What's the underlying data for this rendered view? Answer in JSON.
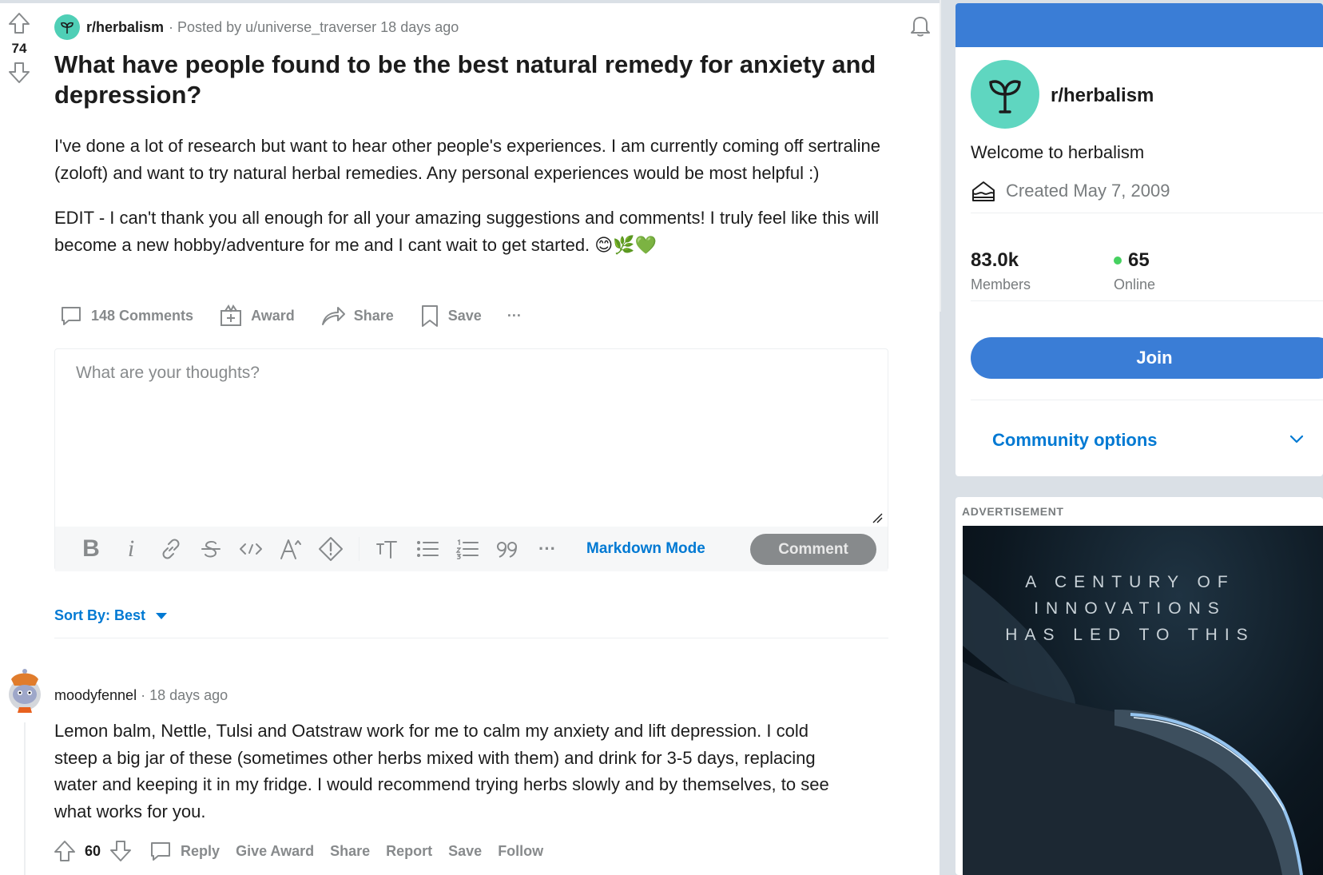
{
  "post": {
    "votes": "74",
    "subreddit": "r/herbalism",
    "posted_by": "· Posted by u/universe_traverser 18 days ago",
    "title": "What have people found to be the best natural remedy for anxiety and depression?",
    "paragraphs": [
      "I've done a lot of research but want to hear other people's experiences. I am currently coming off sertraline (zoloft) and want to try natural herbal remedies. Any personal experiences would be most helpful :)",
      "EDIT - I can't thank you all enough for all your amazing suggestions and comments! I truly feel like this will become a new hobby/adventure for me and I cant wait to get started. 😊🌿💚"
    ],
    "actions": {
      "comments": "148 Comments",
      "award": "Award",
      "share": "Share",
      "save": "Save",
      "more": "···"
    }
  },
  "editor": {
    "placeholder": "What are your thoughts?",
    "toolbar": {
      "bold": "B",
      "italic": "i",
      "more": "···",
      "markdown_mode": "Markdown Mode",
      "comment_button": "Comment"
    }
  },
  "sort": {
    "label": "Sort By: Best"
  },
  "comment": {
    "author": "moodyfennel",
    "time": "· 18 days ago",
    "body": "Lemon balm, Nettle, Tulsi and Oatstraw work for me to calm my anxiety and lift depression. I cold steep a big jar of these (sometimes other herbs mixed with them) and drink for 3-5 days, replacing water and keeping it in my fridge. I would recommend trying herbs slowly and by themselves, to see what works for you.",
    "votes": "60",
    "actions": {
      "reply": "Reply",
      "give_award": "Give Award",
      "share": "Share",
      "report": "Report",
      "save": "Save",
      "follow": "Follow"
    }
  },
  "sidebar": {
    "name": "r/herbalism",
    "welcome": "Welcome to herbalism",
    "created": "Created May 7, 2009",
    "members_count": "83.0k",
    "members_label": "Members",
    "online_count": "65",
    "online_label": "Online",
    "join": "Join",
    "community_options": "Community options"
  },
  "ad": {
    "label": "ADVERTISEMENT",
    "text_lines": [
      "A CENTURY OF",
      "INNOVATIONS",
      "HAS LED TO THIS"
    ]
  },
  "colors": {
    "brand_blue": "#0079d3",
    "sidebar_blue": "#3a7dd6",
    "subreddit_teal": "#4fcfb6",
    "online_green": "#46d160"
  }
}
